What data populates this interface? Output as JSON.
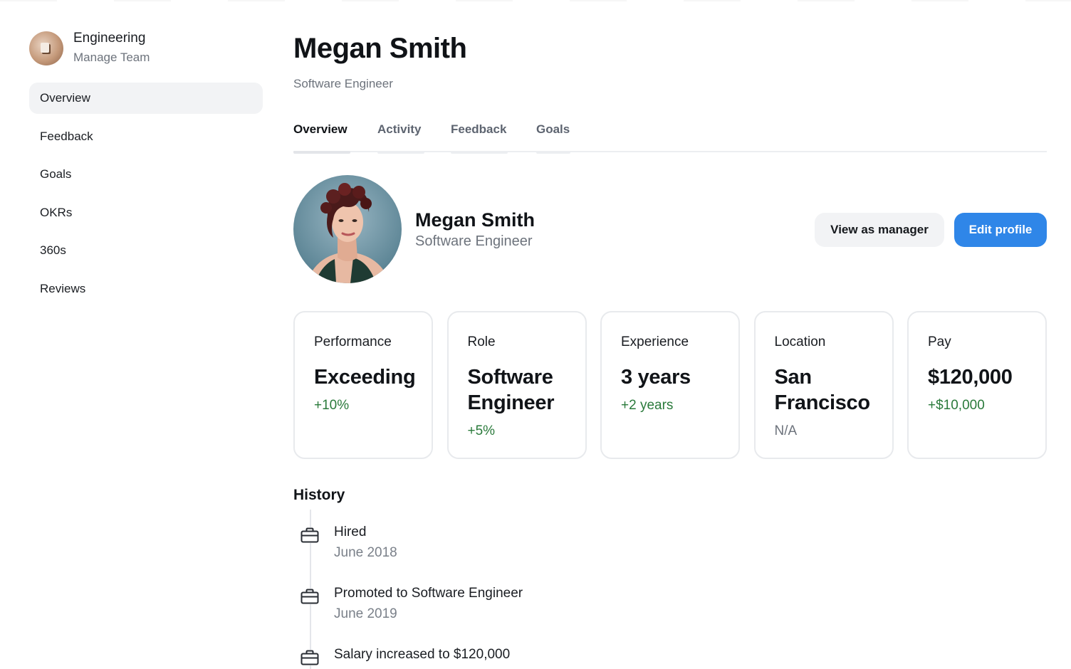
{
  "sidebar": {
    "team_name": "Engineering",
    "team_sub": "Manage Team",
    "items": [
      {
        "label": "Overview",
        "active": true
      },
      {
        "label": "Feedback"
      },
      {
        "label": "Goals"
      },
      {
        "label": "OKRs"
      },
      {
        "label": "360s"
      },
      {
        "label": "Reviews"
      }
    ]
  },
  "header": {
    "title": "Megan Smith",
    "subtitle": "Software Engineer"
  },
  "tabs": [
    {
      "label": "Overview",
      "active": true
    },
    {
      "label": "Activity"
    },
    {
      "label": "Feedback"
    },
    {
      "label": "Goals"
    }
  ],
  "profile": {
    "name": "Megan Smith",
    "role": "Software Engineer",
    "view_as_manager_label": "View as manager",
    "edit_profile_label": "Edit profile"
  },
  "stats": [
    {
      "label": "Performance",
      "value": "Exceeding",
      "delta": "+10%",
      "delta_tone": "positive"
    },
    {
      "label": "Role",
      "value": "Software Engineer",
      "delta": "+5%",
      "delta_tone": "positive"
    },
    {
      "label": "Experience",
      "value": "3 years",
      "delta": "+2 years",
      "delta_tone": "positive"
    },
    {
      "label": "Location",
      "value": "San Francisco",
      "delta": "N/A",
      "delta_tone": "neutral"
    },
    {
      "label": "Pay",
      "value": "$120,000",
      "delta": "+$10,000",
      "delta_tone": "positive"
    }
  ],
  "history": {
    "title": "History",
    "items": [
      {
        "title": "Hired",
        "date": "June 2018",
        "icon": "briefcase-icon"
      },
      {
        "title": "Promoted to Software Engineer",
        "date": "June 2019",
        "icon": "briefcase-icon"
      },
      {
        "title": "Salary increased to $120,000",
        "date": "",
        "icon": "briefcase-icon"
      }
    ]
  },
  "colors": {
    "accent": "#2f86e8",
    "positive": "#2a7a3b",
    "muted": "#6d737c",
    "nav_active_bg": "#f2f3f5"
  }
}
